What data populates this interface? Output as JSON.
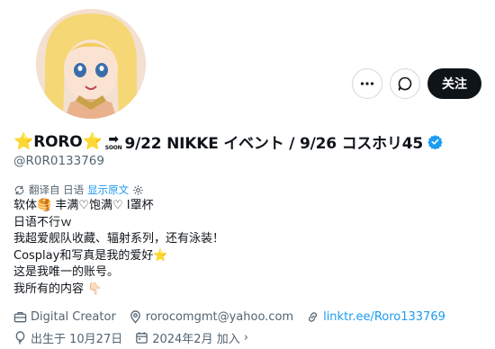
{
  "profile": {
    "name_prefix_star": "⭐",
    "name": "RORO",
    "name_suffix_star": "⭐",
    "soon_arrow": "➡",
    "soon_label": "SOON",
    "name_tail": "9/22 NIKKE イベント / 9/26 コスホリ45",
    "handle": "@R0R0133769"
  },
  "actions": {
    "follow_label": "关注"
  },
  "translate": {
    "source": "翻译自 日语",
    "show_original": "显示原文"
  },
  "bio": {
    "lines": [
      "软体🥞 丰满♡饱满♡ I罩杯",
      "日语不行ｗ",
      "我超爱舰队收藏、辐射系列，还有泳装！",
      "Cosplay和写真是我的爱好⭐",
      "这是我唯一的账号。",
      "我所有的内容 👇🏻"
    ]
  },
  "meta": {
    "category": "Digital Creator",
    "email": "rorocomgmt@yahoo.com",
    "link": "linktr.ee/Roro133769",
    "birthday": "出生于 10月27日",
    "joined": "2024年2月 加入",
    "joined_chevron": "›"
  },
  "colors": {
    "accent": "#1d9bf0",
    "secondary_text": "#536471",
    "primary_text": "#0f1419",
    "follow_bg": "#0f1419"
  }
}
